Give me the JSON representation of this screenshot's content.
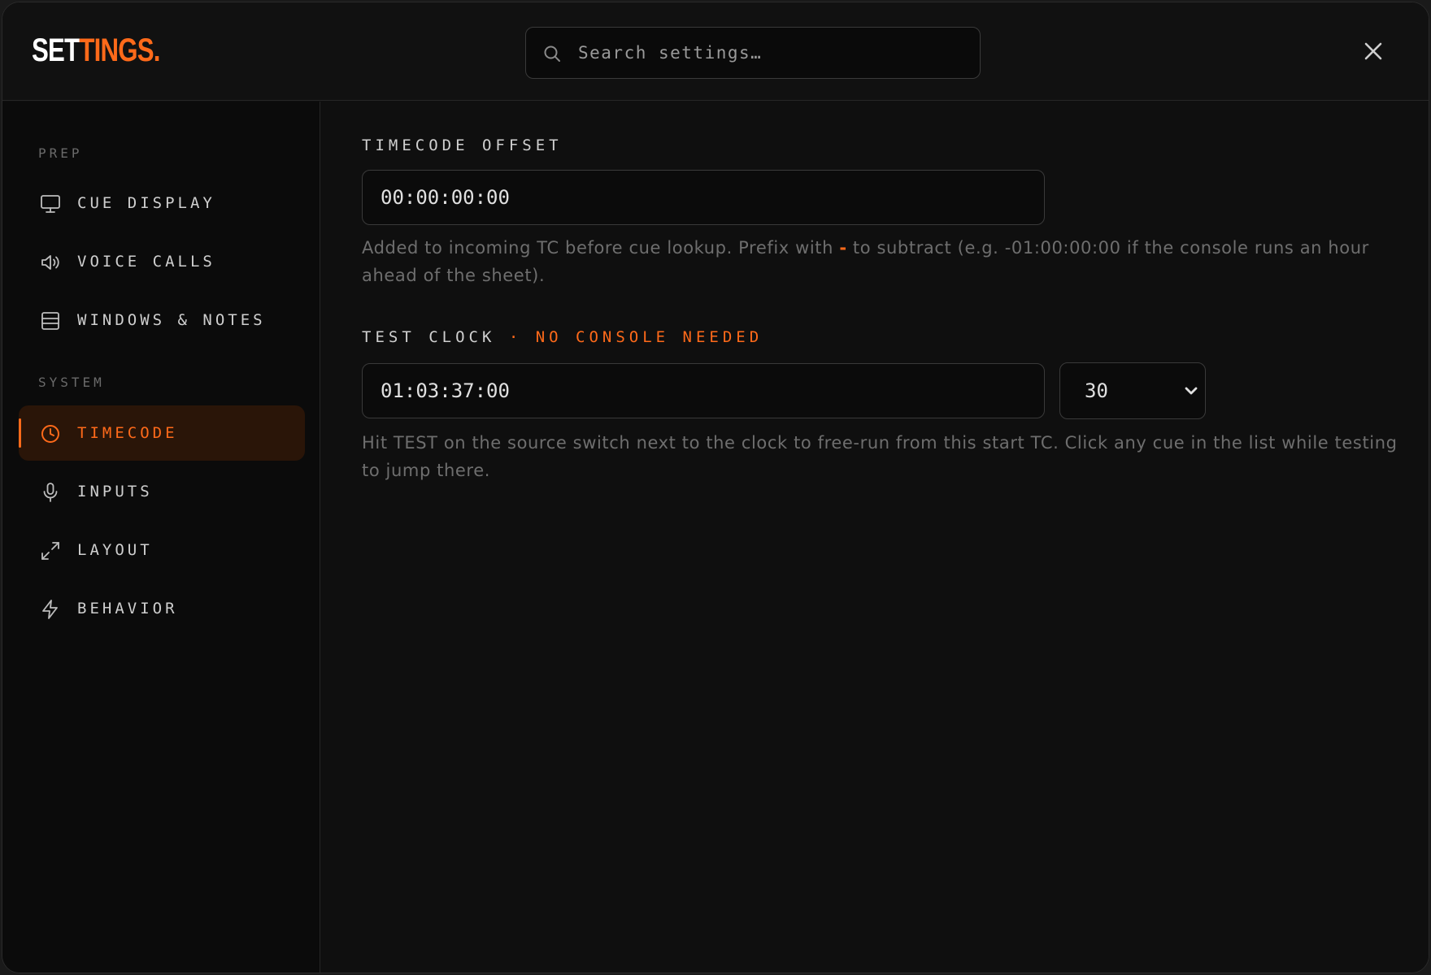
{
  "header": {
    "logo_part1": "SET",
    "logo_part2": "TINGS.",
    "search_placeholder": "Search settings…",
    "close_icon": "close-icon"
  },
  "sidebar": {
    "sections": [
      {
        "label": "PREP",
        "items": [
          {
            "label": "CUE DISPLAY",
            "icon": "monitor-icon"
          },
          {
            "label": "VOICE CALLS",
            "icon": "speaker-icon"
          },
          {
            "label": "WINDOWS & NOTES",
            "icon": "panels-icon"
          }
        ]
      },
      {
        "label": "SYSTEM",
        "items": [
          {
            "label": "TIMECODE",
            "icon": "clock-icon",
            "active": true
          },
          {
            "label": "INPUTS",
            "icon": "microphone-icon"
          },
          {
            "label": "LAYOUT",
            "icon": "expand-icon"
          },
          {
            "label": "BEHAVIOR",
            "icon": "lightning-icon"
          }
        ]
      }
    ]
  },
  "main": {
    "offset": {
      "label": "TIMECODE OFFSET",
      "value": "00:00:00:00",
      "help_before": "Added to incoming TC before cue lookup. Prefix with ",
      "help_dash": "-",
      "help_after": " to subtract (e.g. -01:00:00:00 if the console runs an hour ahead of the sheet)."
    },
    "test_clock": {
      "label": "TEST CLOCK",
      "label_accent": "· NO CONSOLE NEEDED",
      "value": "01:03:37:00",
      "fps_value": "30",
      "help": "Hit TEST on the source switch next to the clock to free-run from this start TC. Click any cue in the list while testing to jump there."
    }
  },
  "colors": {
    "accent": "#ff6a1a",
    "background": "#0f0f0f",
    "sidebar": "#0b0b0b",
    "active_item_bg": "#2a1508"
  }
}
